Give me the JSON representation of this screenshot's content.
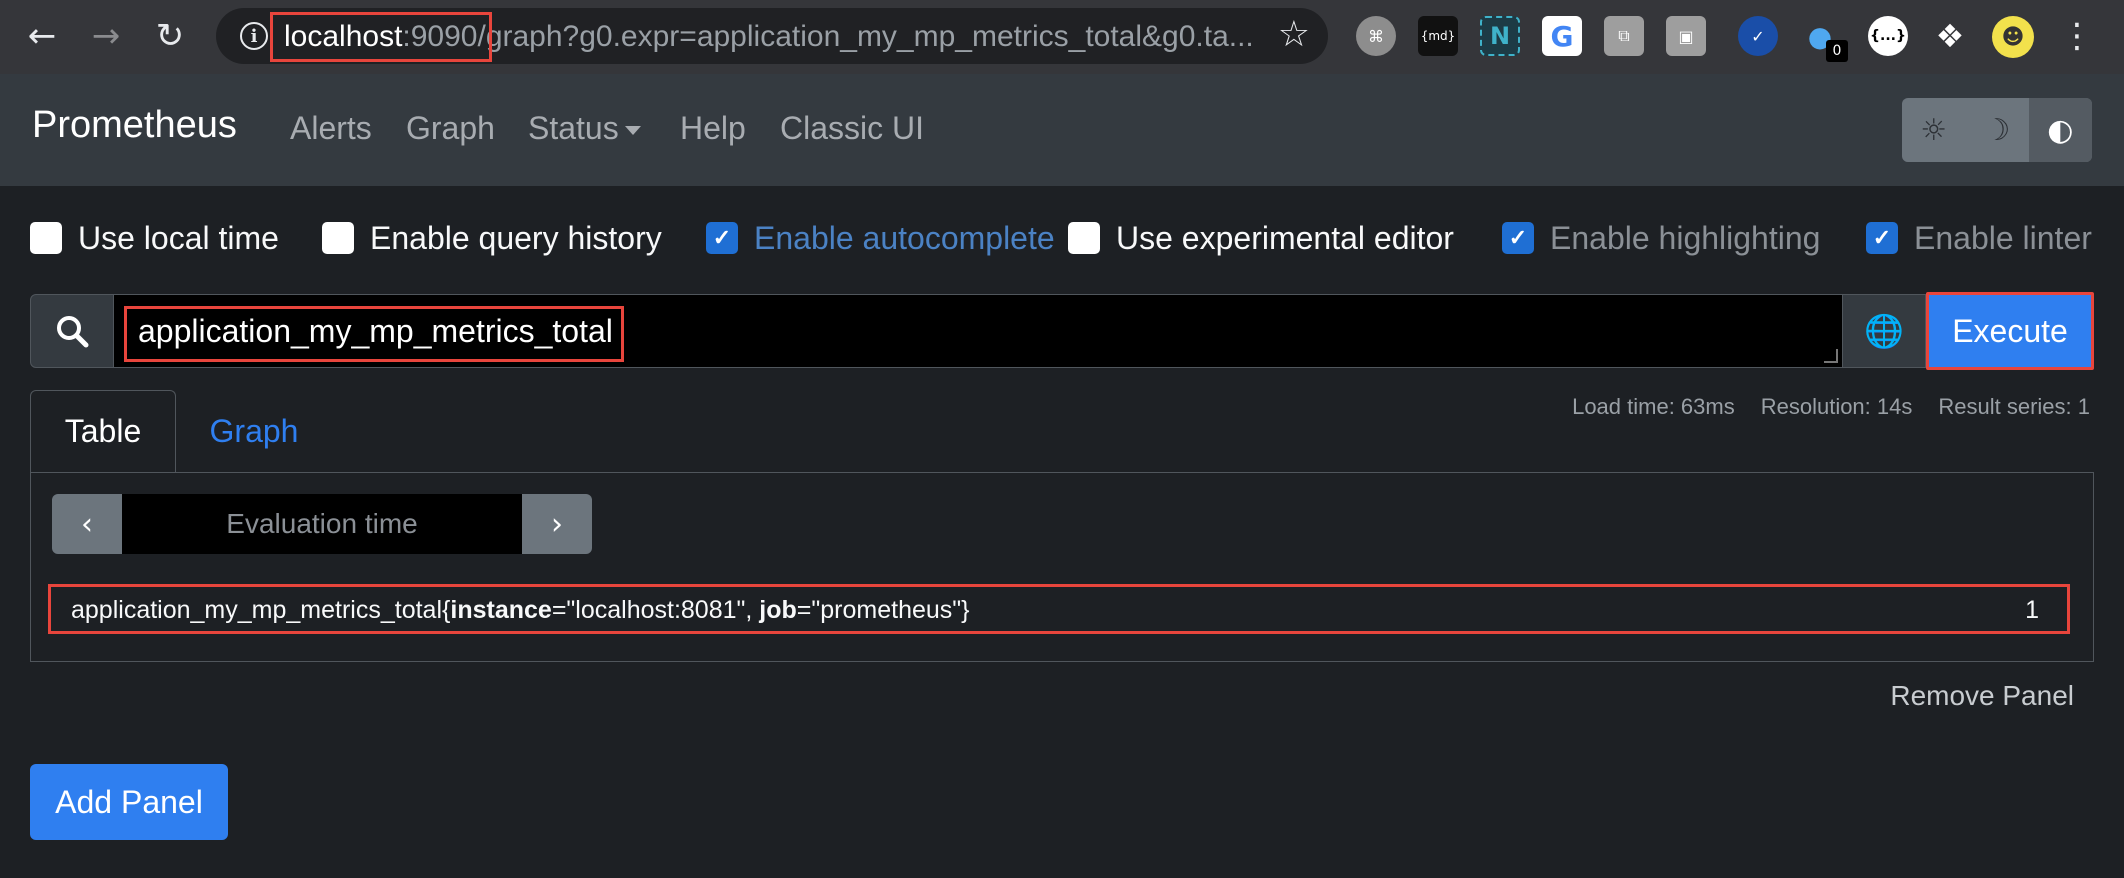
{
  "browser": {
    "url_host": "localhost",
    "url_port": ":9090",
    "url_path": "/graph?g0.expr=application_my_mp_metrics_total&g0.ta...",
    "extension_badge": "0",
    "extension_md": "{md}",
    "extension_n": "N",
    "extension_g": "G",
    "extension_ellipsis": "{...}"
  },
  "navbar": {
    "brand": "Prometheus",
    "links": [
      "Alerts",
      "Graph",
      "Status",
      "Help",
      "Classic UI"
    ]
  },
  "options": [
    {
      "label": "Use local time",
      "checked": false
    },
    {
      "label": "Enable query history",
      "checked": false
    },
    {
      "label": "Enable autocomplete",
      "checked": true
    },
    {
      "label": "Use experimental editor",
      "checked": false
    },
    {
      "label": "Enable highlighting",
      "checked": true
    },
    {
      "label": "Enable linter",
      "checked": true
    }
  ],
  "query": {
    "expression": "application_my_mp_metrics_total",
    "execute_label": "Execute"
  },
  "tabs": {
    "table": "Table",
    "graph": "Graph"
  },
  "stats": {
    "load_time": "Load time: 63ms",
    "resolution": "Resolution: 14s",
    "result_series": "Result series: 1"
  },
  "eval_time": {
    "placeholder": "Evaluation time"
  },
  "result": {
    "metric": "application_my_mp_metrics_total",
    "open_brace": "{",
    "label1_key": "instance",
    "label1_rest": "=\"localhost:8081\", ",
    "label2_key": "job",
    "label2_rest": "=\"prometheus\"}",
    "value": "1"
  },
  "actions": {
    "remove_panel": "Remove Panel",
    "add_panel": "Add Panel"
  },
  "colors": {
    "accent": "#2f7ff0",
    "highlight_box": "#e8453c",
    "navbar": "#343a40",
    "background": "#1d2024"
  }
}
